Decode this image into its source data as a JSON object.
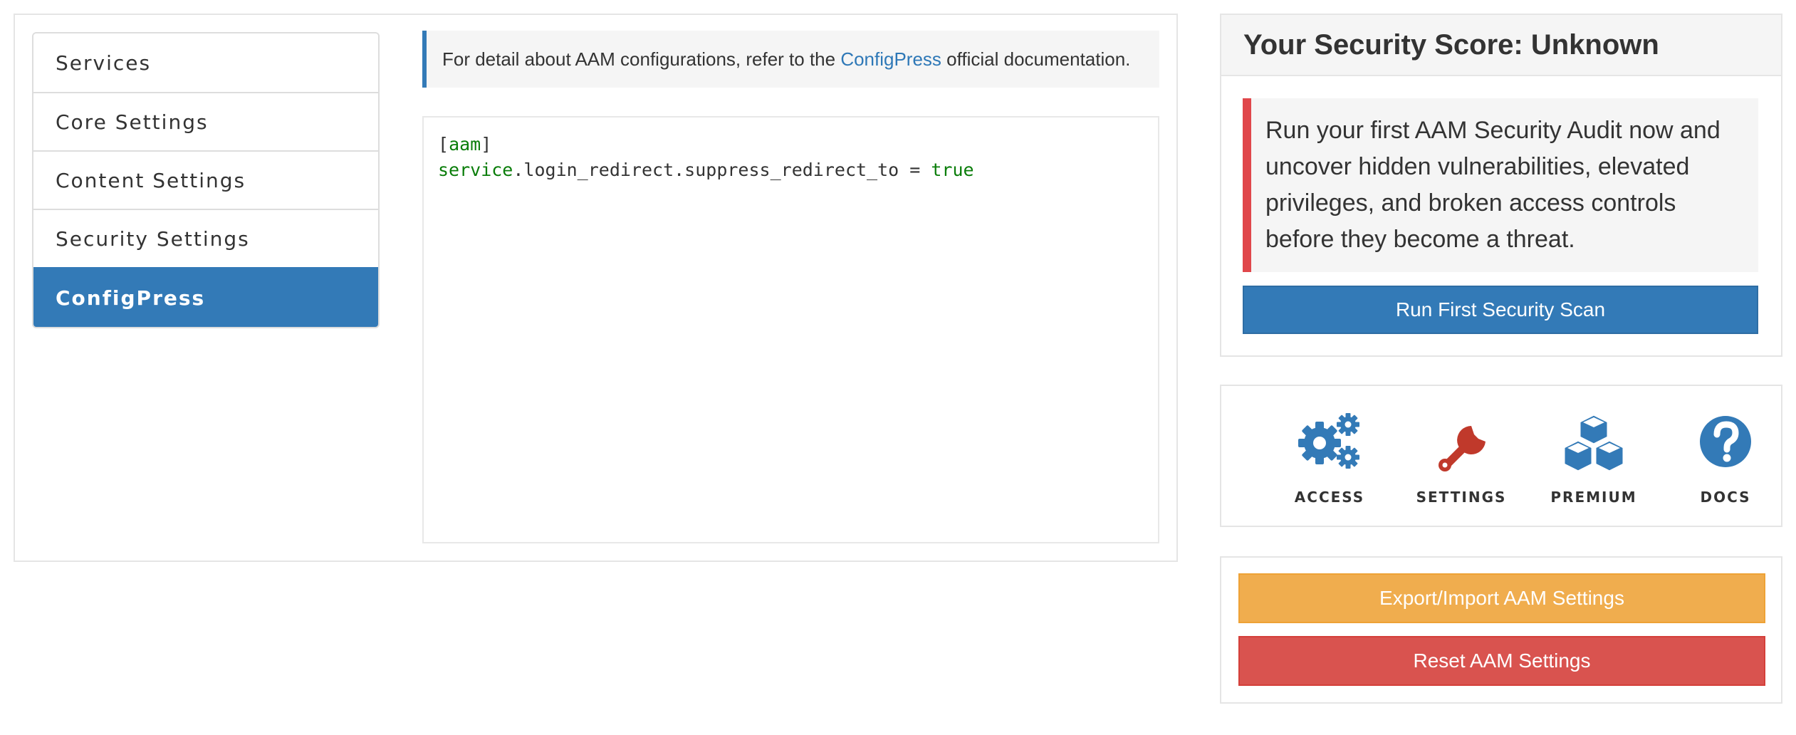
{
  "nav": {
    "items": [
      {
        "label": "Services",
        "active": false
      },
      {
        "label": "Core Settings",
        "active": false
      },
      {
        "label": "Content Settings",
        "active": false
      },
      {
        "label": "Security Settings",
        "active": false
      },
      {
        "label": "ConfigPress",
        "active": true
      }
    ]
  },
  "info": {
    "prefix": "For detail about AAM configurations, refer to the ",
    "link": "ConfigPress",
    "suffix": " official documentation."
  },
  "editor": {
    "line1_open": "[",
    "line1_section": "aam",
    "line1_close": "]",
    "line2_key_a": "service",
    "line2_key_b": ".login_redirect.suppress_redirect_to = ",
    "line2_value": "true"
  },
  "score": {
    "title": "Your Security Score: Unknown",
    "message": "Run your first AAM Security Audit now and uncover hidden vulnerabilities, elevated privileges, and broken access controls before they become a threat.",
    "button": "Run First Security Scan"
  },
  "links": [
    {
      "label": "ACCESS",
      "icon": "gears-icon"
    },
    {
      "label": "SETTINGS",
      "icon": "wrench-icon"
    },
    {
      "label": "PREMIUM",
      "icon": "cubes-icon"
    },
    {
      "label": "DOCS",
      "icon": "question-circle-icon"
    }
  ],
  "actions": {
    "export_import": "Export/Import AAM Settings",
    "reset": "Reset AAM Settings"
  },
  "colors": {
    "primary": "#337ab7",
    "danger_border": "#e0474b",
    "warning": "#f0ad4e",
    "danger": "#d9534f",
    "settings_icon": "#c0392b",
    "code_green": "#0a7d0a"
  }
}
